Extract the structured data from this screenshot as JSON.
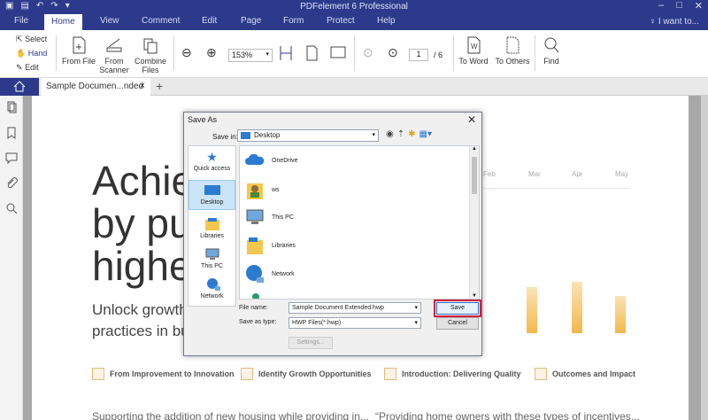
{
  "titlebar": {
    "title": "PDFelement 6 Professional"
  },
  "menu": {
    "items": [
      "File",
      "Home",
      "View",
      "Comment",
      "Edit",
      "Page",
      "Form",
      "Protect",
      "Help"
    ],
    "iwant": "I want to..."
  },
  "ribbon": {
    "select": "Select",
    "hand": "Hand",
    "edit": "Edit",
    "from_file": "From File",
    "from_scanner_1": "From",
    "from_scanner_2": "Scanner",
    "combine_1": "Combine",
    "combine_2": "Files",
    "zoom": "153%",
    "page_current": "1",
    "page_total": "/ 6",
    "to_word": "To Word",
    "to_others": "To Others",
    "find": "Find"
  },
  "tabs": {
    "doc_title": "Sample Documen...nded"
  },
  "document": {
    "headline": [
      "Achie",
      "by pu",
      "highe"
    ],
    "subtext": [
      "Unlock growth fo",
      "practices in busi"
    ],
    "months": [
      "Feb",
      "Mar",
      "Apr",
      "May"
    ],
    "features": [
      "From Improvement to Innovation",
      "Identify Growth Opportunities",
      "Introduction: Delivering Quality",
      "Outcomes and Impact"
    ],
    "bottom_left": "Supporting the addition of new housing while providing in...",
    "bottom_right": "“Providing home owners with these types of incentives..."
  },
  "dialog": {
    "title": "Save As",
    "save_in_label": "Save in:",
    "save_in_value": "Desktop",
    "places": [
      "Quick access",
      "Desktop",
      "Libraries",
      "This PC",
      "Network"
    ],
    "files": [
      "OneDrive",
      "ws",
      "This PC",
      "Libraries",
      "Network"
    ],
    "file_name_label": "File name:",
    "file_name_value": "Sample Document Extended.hwp",
    "save_type_label": "Save as type:",
    "save_type_value": "HWP Files(*.hwp)",
    "save_button": "Save",
    "cancel_button": "Cancel",
    "settings_button": "Settings..."
  },
  "colors": {
    "brand": "#2d3a8c",
    "accent_orange": "#f2b84b",
    "save_highlight": "#d0203a"
  }
}
